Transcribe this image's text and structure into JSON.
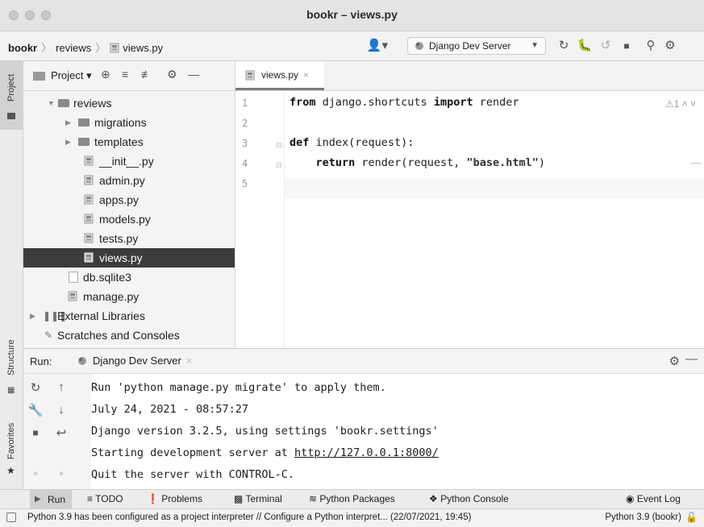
{
  "window": {
    "title": "bookr – views.py"
  },
  "breadcrumb": {
    "project": "bookr",
    "folder": "reviews",
    "file": "views.py"
  },
  "toolbar": {
    "run_config": "Django Dev Server"
  },
  "tool_stripe": {
    "project": "Project",
    "structure": "Structure",
    "favorites": "Favorites"
  },
  "project_panel": {
    "title": "Project",
    "tree": [
      {
        "label": "reviews",
        "kind": "folder-open"
      },
      {
        "label": "migrations",
        "kind": "folder"
      },
      {
        "label": "templates",
        "kind": "folder"
      },
      {
        "label": "__init__.py",
        "kind": "py"
      },
      {
        "label": "admin.py",
        "kind": "py"
      },
      {
        "label": "apps.py",
        "kind": "py"
      },
      {
        "label": "models.py",
        "kind": "py"
      },
      {
        "label": "tests.py",
        "kind": "py"
      },
      {
        "label": "views.py",
        "kind": "py"
      },
      {
        "label": "db.sqlite3",
        "kind": "db"
      },
      {
        "label": "manage.py",
        "kind": "py"
      },
      {
        "label": "External Libraries",
        "kind": "lib"
      },
      {
        "label": "Scratches and Consoles",
        "kind": "scratch"
      }
    ]
  },
  "editor": {
    "tab": "views.py",
    "line_numbers": [
      "1",
      "2",
      "3",
      "4",
      "5"
    ],
    "lines": {
      "l1_kw1": "from",
      "l1_mod": " django.shortcuts ",
      "l1_kw2": "import",
      "l1_name": " render",
      "l3_kw": "def",
      "l3_rest": " index(request):",
      "l4_indent": "    ",
      "l4_kw": "return",
      "l4_mid": " render(request, ",
      "l4_str": "\"base.html\"",
      "l4_end": ")"
    },
    "inspection": "⚠1 ˄ ˅"
  },
  "run_panel": {
    "label": "Run:",
    "tab": "Django Dev Server",
    "console": [
      "Run 'python manage.py migrate' to apply them.",
      "July 24, 2021 - 08:57:27",
      "Django version 3.2.5, using settings 'bookr.settings'",
      "Quit the server with CONTROL-C."
    ],
    "server_line_prefix": "Starting development server at ",
    "server_url": "http://127.0.0.1:8000/"
  },
  "tool_windows": {
    "run": "Run",
    "todo": "TODO",
    "problems": "Problems",
    "terminal": "Terminal",
    "python_packages": "Python Packages",
    "python_console": "Python Console",
    "event_log": "Event Log"
  },
  "status_bar": {
    "message": "Python 3.9 has been configured as a project interpreter // Configure a Python interpret... (22/07/2021, 19:45)",
    "interpreter": "Python 3.9 (bookr)"
  }
}
